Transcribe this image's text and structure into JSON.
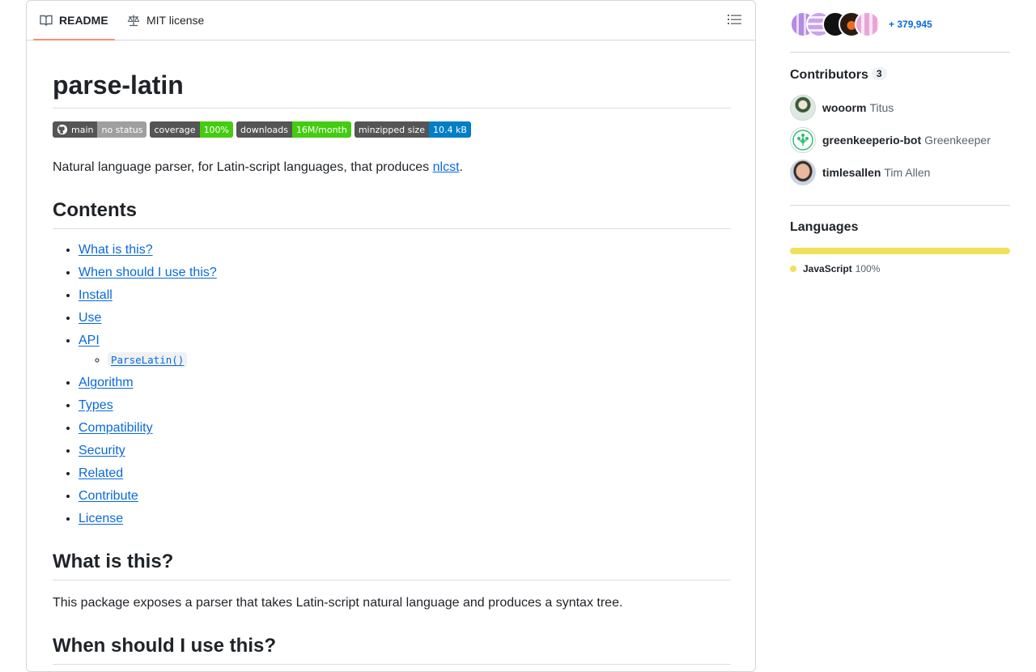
{
  "tabs": {
    "readme": "README",
    "license": "MIT license"
  },
  "readme": {
    "title": "parse-latin",
    "badges": [
      {
        "left": "main",
        "right": "no status",
        "color": "#9f9f9f"
      },
      {
        "left": "coverage",
        "right": "100%",
        "color": "#4c1"
      },
      {
        "left": "downloads",
        "right": "16M/month",
        "color": "#4c1"
      },
      {
        "left": "minzipped size",
        "right": "10.4 kB",
        "color": "#007ec6"
      }
    ],
    "intro_text": "Natural language parser, for Latin-script languages, that produces ",
    "intro_link": "nlcst",
    "intro_end": ".",
    "contents_heading": "Contents",
    "toc": [
      "What is this?",
      "When should I use this?",
      "Install",
      "Use",
      "API",
      "ParseLatin()",
      "Algorithm",
      "Types",
      "Compatibility",
      "Security",
      "Related",
      "Contribute",
      "License"
    ],
    "what_heading": "What is this?",
    "what_text": "This package exposes a parser that takes Latin-script natural language and produces a syntax tree.",
    "when_heading": "When should I use this?"
  },
  "sidebar": {
    "used_by_count": "+ 379,945",
    "contributors_heading": "Contributors",
    "contributors_count": "3",
    "contributors": [
      {
        "login": "wooorm",
        "name": "Titus"
      },
      {
        "login": "greenkeeperio-bot",
        "name": "Greenkeeper"
      },
      {
        "login": "timlesallen",
        "name": "Tim Allen"
      }
    ],
    "languages_heading": "Languages",
    "language": {
      "name": "JavaScript",
      "percent": "100%",
      "color": "#f1e05a"
    }
  }
}
